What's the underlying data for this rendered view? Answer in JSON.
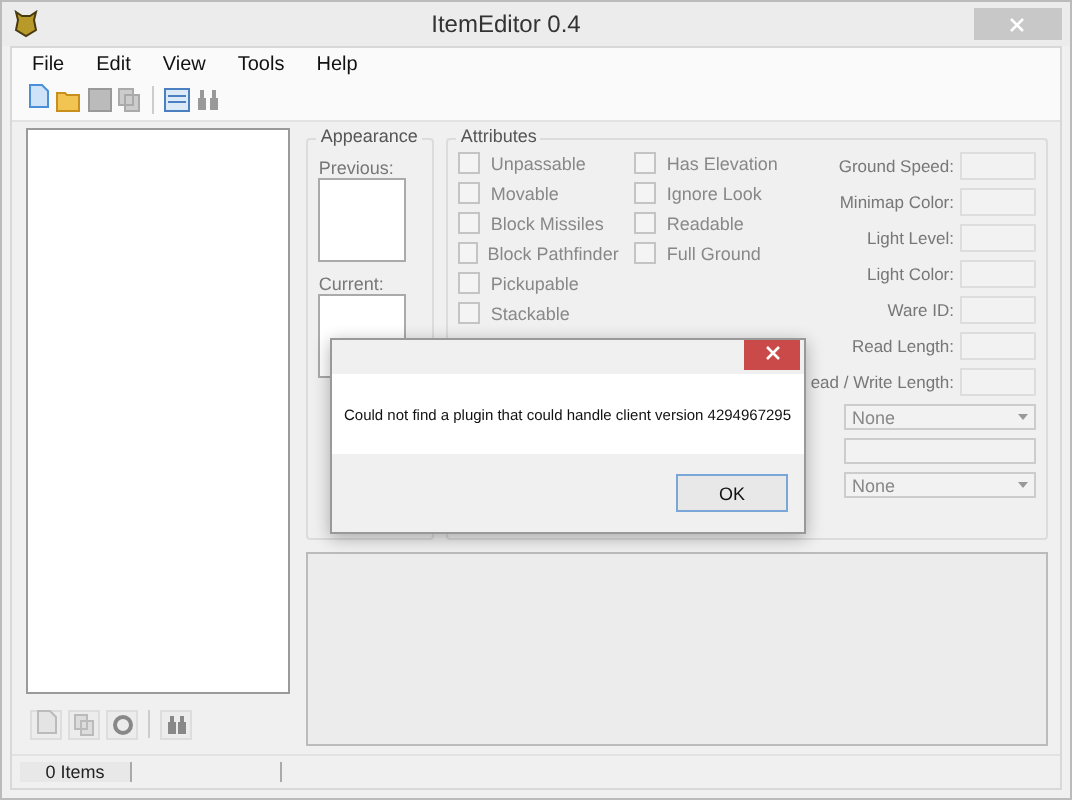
{
  "window": {
    "title": "ItemEditor 0.4"
  },
  "menu": [
    "File",
    "Edit",
    "View",
    "Tools",
    "Help"
  ],
  "appearance": {
    "title": "Appearance",
    "previous_label": "Previous:",
    "current_label": "Current:"
  },
  "attributes": {
    "title": "Attributes",
    "flags": [
      {
        "label": "Unpassable",
        "checked": false
      },
      {
        "label": "Movable",
        "checked": false
      },
      {
        "label": "Block Missiles",
        "checked": false
      },
      {
        "label": "Block Pathfinder",
        "checked": false
      },
      {
        "label": "Pickupable",
        "checked": false
      },
      {
        "label": "Stackable",
        "checked": false
      },
      {
        "label": "Has Elevation",
        "checked": false
      },
      {
        "label": "Ignore Look",
        "checked": false
      },
      {
        "label": "Readable",
        "checked": false
      },
      {
        "label": "Full Ground",
        "checked": false
      }
    ],
    "fields": [
      {
        "label": "Ground Speed:"
      },
      {
        "label": "Minimap Color:"
      },
      {
        "label": "Light Level:"
      },
      {
        "label": "Light Color:"
      },
      {
        "label": "Ware ID:"
      },
      {
        "label": "Read Length:"
      },
      {
        "label": "ead / Write Length:"
      }
    ],
    "selectors": [
      {
        "kind": "select",
        "value": "None"
      },
      {
        "kind": "text"
      },
      {
        "kind": "select",
        "value": "None"
      }
    ]
  },
  "status_bar": {
    "items": "0 Items"
  },
  "dialog": {
    "message": "Could not find a plugin that could handle client version 4294967295",
    "buttons": [
      "OK"
    ]
  }
}
